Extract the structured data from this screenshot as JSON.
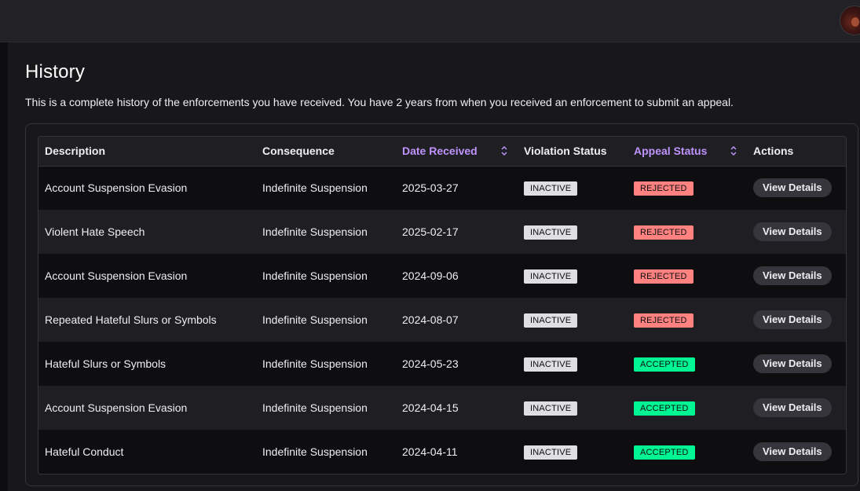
{
  "page": {
    "title": "History",
    "description": "This is a complete history of the enforcements you have received. You have 2 years from when you received an enforcement to submit an appeal."
  },
  "table": {
    "headers": {
      "description": "Description",
      "consequence": "Consequence",
      "date_received": "Date Received",
      "violation_status": "Violation Status",
      "appeal_status": "Appeal Status",
      "actions": "Actions"
    },
    "sortable_color": "#bf94ff",
    "rows": [
      {
        "description": "Account Suspension Evasion",
        "consequence": "Indefinite Suspension",
        "date": "2025-03-27",
        "violation_status": "INACTIVE",
        "appeal_status": "REJECTED",
        "action": "View Details"
      },
      {
        "description": "Violent Hate Speech",
        "consequence": "Indefinite Suspension",
        "date": "2025-02-17",
        "violation_status": "INACTIVE",
        "appeal_status": "REJECTED",
        "action": "View Details"
      },
      {
        "description": "Account Suspension Evasion",
        "consequence": "Indefinite Suspension",
        "date": "2024-09-06",
        "violation_status": "INACTIVE",
        "appeal_status": "REJECTED",
        "action": "View Details"
      },
      {
        "description": "Repeated Hateful Slurs or Symbols",
        "consequence": "Indefinite Suspension",
        "date": "2024-08-07",
        "violation_status": "INACTIVE",
        "appeal_status": "REJECTED",
        "action": "View Details"
      },
      {
        "description": "Hateful Slurs or Symbols",
        "consequence": "Indefinite Suspension",
        "date": "2024-05-23",
        "violation_status": "INACTIVE",
        "appeal_status": "ACCEPTED",
        "action": "View Details"
      },
      {
        "description": "Account Suspension Evasion",
        "consequence": "Indefinite Suspension",
        "date": "2024-04-15",
        "violation_status": "INACTIVE",
        "appeal_status": "ACCEPTED",
        "action": "View Details"
      },
      {
        "description": "Hateful Conduct",
        "consequence": "Indefinite Suspension",
        "date": "2024-04-11",
        "violation_status": "INACTIVE",
        "appeal_status": "ACCEPTED",
        "action": "View Details"
      }
    ]
  },
  "status_colors": {
    "INACTIVE": "#dedee3",
    "REJECTED": "#ff8280",
    "ACCEPTED": "#00f593"
  }
}
